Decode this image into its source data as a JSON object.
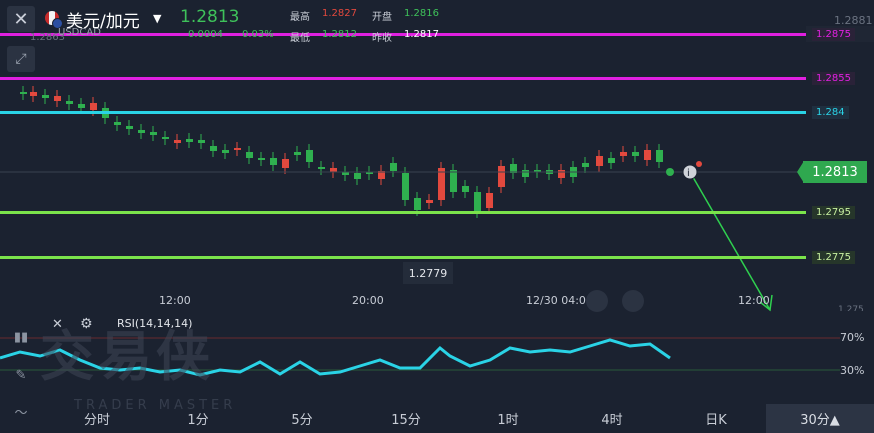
{
  "header": {
    "title": "美元/加元",
    "code": "USDCAD",
    "price": "1.2813",
    "change": "0.0004",
    "change_pct": "0.03%",
    "stats": {
      "high_label": "最高",
      "high_value": "1.2827",
      "open_label": "开盘",
      "open_value": "1.2816",
      "low_label": "最低",
      "low_value": "1.2812",
      "prev_label": "昨收",
      "prev_value": "1.2817"
    },
    "ghost_high": "1.2863"
  },
  "price_axis": {
    "top_label": "1.2881",
    "lines": [
      {
        "label": "1.2875",
        "color": "#e020e0"
      },
      {
        "label": "1.2855",
        "color": "#e020e0"
      },
      {
        "label": "1.284",
        "color": "#2ad3e6"
      },
      {
        "label": "1.2795",
        "color": "#7be34b"
      },
      {
        "label": "1.2775",
        "color": "#7be34b"
      }
    ],
    "current": "1.2813",
    "bottom_partial": "1.275"
  },
  "time_axis": [
    "12:00",
    "20:00",
    "12/30 04:00",
    "12:00"
  ],
  "min_marker": "1.2779",
  "rsi": {
    "label": "RSI(14,14,14)",
    "levels": [
      "70%",
      "30%"
    ]
  },
  "watermark": {
    "text": "交易侠",
    "sub": "TRADER MASTER"
  },
  "tabs": [
    {
      "label": "分时"
    },
    {
      "label": "1分"
    },
    {
      "label": "5分"
    },
    {
      "label": "15分"
    },
    {
      "label": "1时"
    },
    {
      "label": "4时"
    },
    {
      "label": "日K"
    },
    {
      "label": "30分▲"
    }
  ],
  "colors": {
    "up": "#e2493e",
    "down": "#2fb04f",
    "rsi": "#2ad3e6"
  }
}
